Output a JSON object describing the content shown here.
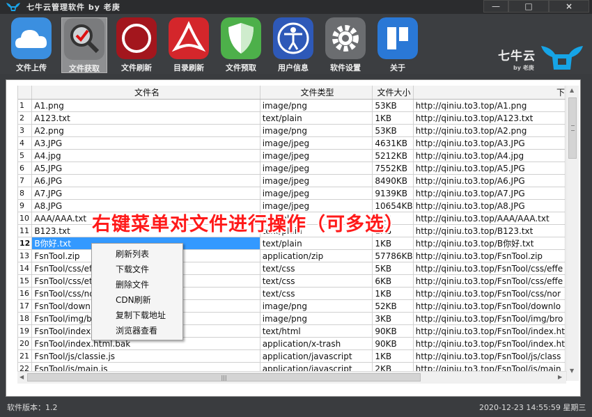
{
  "window": {
    "title": "七牛云管理软件 by 老庚",
    "min_icon": "minimize-icon",
    "max_icon": "maximize-icon",
    "close_icon": "close-icon",
    "min_glyph": "—",
    "max_glyph": "□",
    "close_glyph": "×"
  },
  "toolbar": {
    "items": [
      {
        "label": "文件上传",
        "icon": "cloud-upload-icon"
      },
      {
        "label": "文件获取",
        "icon": "search-file-icon"
      },
      {
        "label": "文件刷新",
        "icon": "refresh-ring-icon"
      },
      {
        "label": "目录刷新",
        "icon": "directory-refresh-icon"
      },
      {
        "label": "文件预取",
        "icon": "shield-icon"
      },
      {
        "label": "用户信息",
        "icon": "user-icon"
      },
      {
        "label": "软件设置",
        "icon": "gear-icon"
      },
      {
        "label": "关于",
        "icon": "about-icon"
      }
    ]
  },
  "brand": {
    "name": "七牛云",
    "by": "by 老庚"
  },
  "table": {
    "columns": [
      "文件名",
      "文件类型",
      "文件大小",
      "下"
    ],
    "rows": [
      [
        "1",
        "A1.png",
        "image/png",
        "53KB",
        "http://qiniu.to3.top/A1.png"
      ],
      [
        "2",
        "A123.txt",
        "text/plain",
        "1KB",
        "http://qiniu.to3.top/A123.txt"
      ],
      [
        "3",
        "A2.png",
        "image/png",
        "53KB",
        "http://qiniu.to3.top/A2.png"
      ],
      [
        "4",
        "A3.JPG",
        "image/jpeg",
        "4631KB",
        "http://qiniu.to3.top/A3.JPG"
      ],
      [
        "5",
        "A4.jpg",
        "image/jpeg",
        "5212KB",
        "http://qiniu.to3.top/A4.jpg"
      ],
      [
        "6",
        "A5.JPG",
        "image/jpeg",
        "7552KB",
        "http://qiniu.to3.top/A5.JPG"
      ],
      [
        "7",
        "A6.JPG",
        "image/jpeg",
        "8490KB",
        "http://qiniu.to3.top/A6.JPG"
      ],
      [
        "8",
        "A7.JPG",
        "image/jpeg",
        "9139KB",
        "http://qiniu.to3.top/A7.JPG"
      ],
      [
        "9",
        "A8.JPG",
        "image/jpeg",
        "10654KB",
        "http://qiniu.to3.top/A8.JPG"
      ],
      [
        "10",
        "AAA/AAA.txt",
        "text/plain",
        "1KB",
        "http://qiniu.to3.top/AAA/AAA.txt"
      ],
      [
        "11",
        "B123.txt",
        "text/plain",
        "1KB",
        "http://qiniu.to3.top/B123.txt"
      ],
      [
        "12",
        "B你好.txt",
        "text/plain",
        "1KB",
        "http://qiniu.to3.top/B你好.txt"
      ],
      [
        "13",
        "FsnTool.zip",
        "application/zip",
        "57786KB",
        "http://qiniu.to3.top/FsnTool.zip"
      ],
      [
        "14",
        "FsnTool/css/ef",
        "text/css",
        "5KB",
        "http://qiniu.to3.top/FsnTool/css/effe"
      ],
      [
        "15",
        "FsnTool/css/et",
        "text/css",
        "6KB",
        "http://qiniu.to3.top/FsnTool/css/effe"
      ],
      [
        "16",
        "FsnTool/css/no",
        "text/css",
        "1KB",
        "http://qiniu.to3.top/FsnTool/css/nor"
      ],
      [
        "17",
        "FsnTool/down",
        "image/png",
        "52KB",
        "http://qiniu.to3.top/FsnTool/downlo"
      ],
      [
        "18",
        "FsnTool/img/b",
        "image/png",
        "3KB",
        "http://qiniu.to3.top/FsnTool/img/bro"
      ],
      [
        "19",
        "FsnTool/index",
        "text/html",
        "90KB",
        "http://qiniu.to3.top/FsnTool/index.ht"
      ],
      [
        "20",
        "FsnTool/index.html.bak",
        "application/x-trash",
        "90KB",
        "http://qiniu.to3.top/FsnTool/index.ht"
      ],
      [
        "21",
        "FsnTool/js/classie.js",
        "application/javascript",
        "1KB",
        "http://qiniu.to3.top/FsnTool/js/class"
      ],
      [
        "22",
        "FsnTool/js/main.js",
        "application/javascript",
        "2KB",
        "http://qiniu.to3.top/FsnTool/js/main"
      ]
    ],
    "selected_row": 12
  },
  "context_menu": {
    "items": [
      "刷新列表",
      "下载文件",
      "删除文件",
      "CDN刷新",
      "复制下载地址",
      "浏览器查看"
    ]
  },
  "annotation": "右键菜单对文件进行操作（可多选）",
  "status": {
    "version": "软件版本：1.2",
    "datetime": "2020-12-23 14:55:59 星期三"
  },
  "colors": {
    "selection": "#3399ff",
    "annotation": "#ff1a1a",
    "chrome": "#3c3e41"
  }
}
